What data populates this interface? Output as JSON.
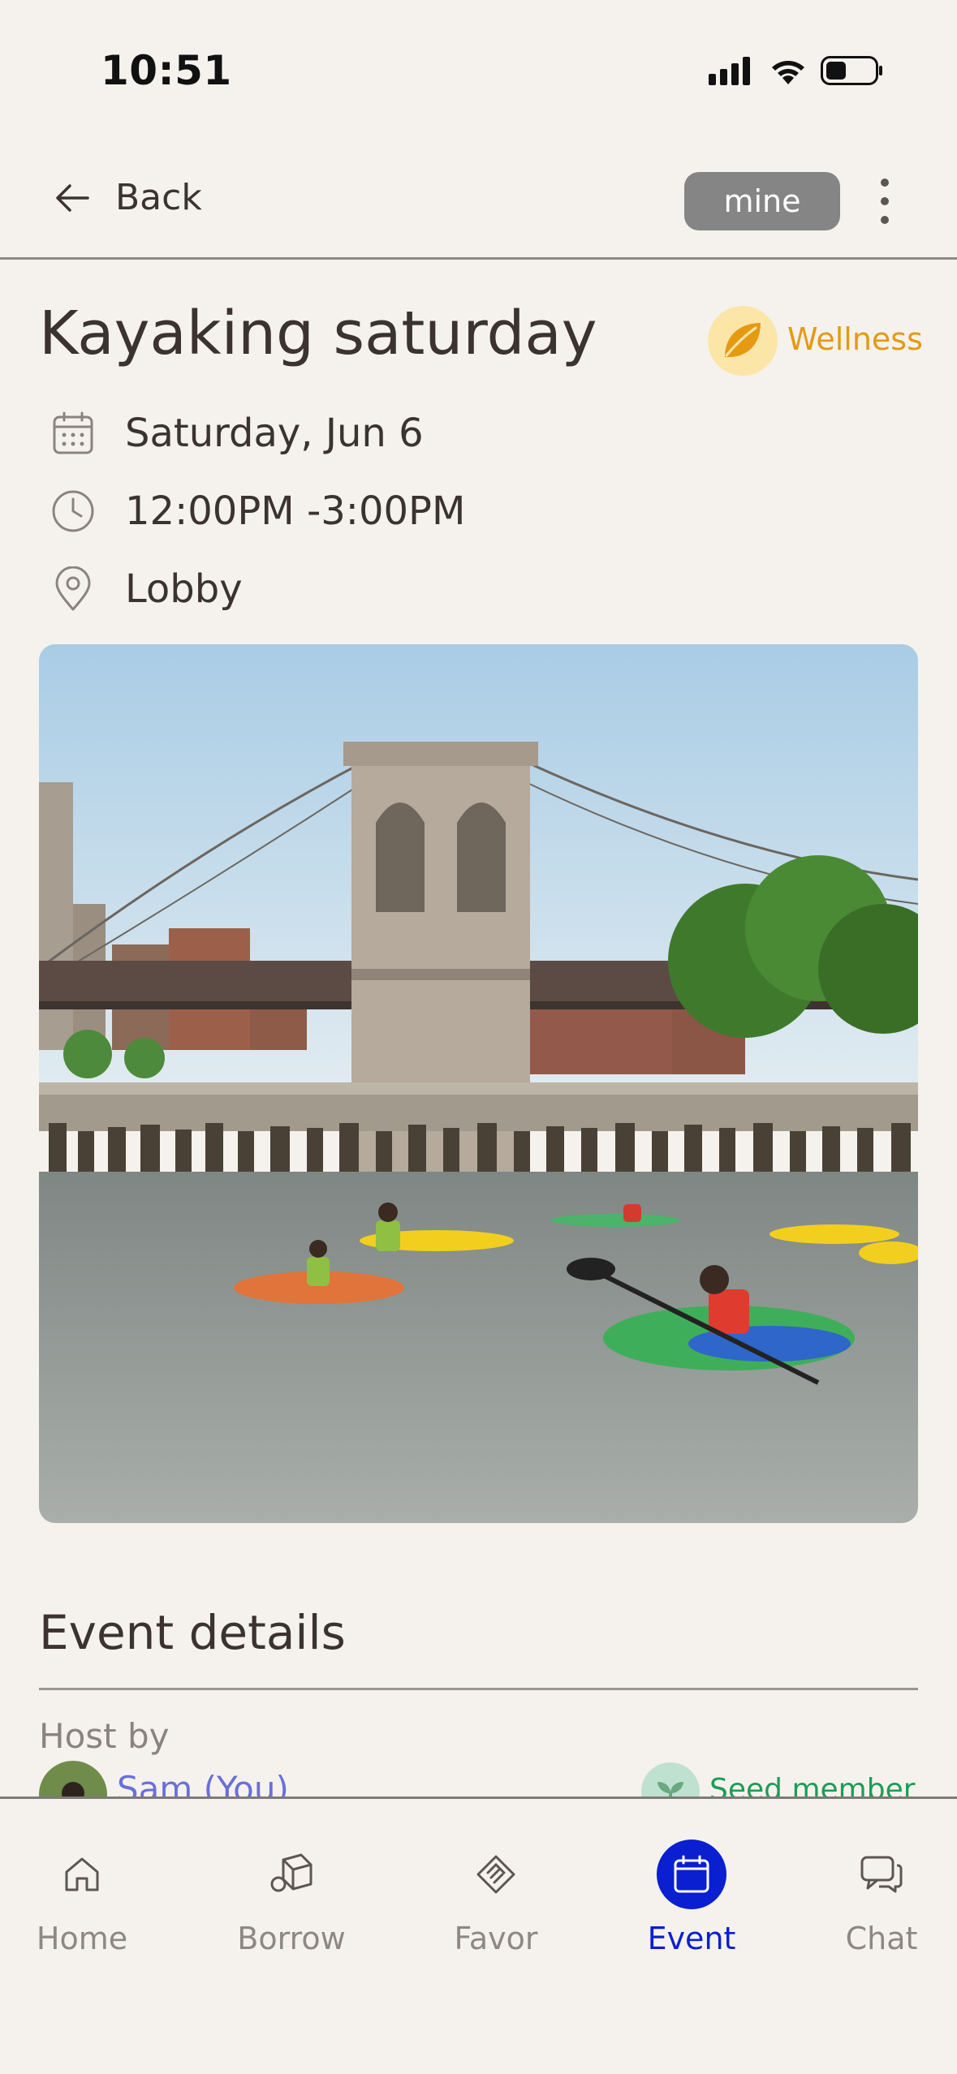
{
  "status_bar": {
    "time": "10:51"
  },
  "header": {
    "back_label": "Back",
    "ownership_badge": "mine"
  },
  "event": {
    "title": "Kayaking saturday",
    "category": {
      "label": "Wellness",
      "icon": "leaf-icon",
      "color": "#e59a12"
    },
    "date": "Saturday, Jun 6",
    "time": "12:00PM -3:00PM",
    "location": "Lobby",
    "photo": "kayakers-under-brooklyn-bridge"
  },
  "details": {
    "section_title": "Event details",
    "host_label": "Host by",
    "host_name": "Sam (You)",
    "member_badge": "Seed member"
  },
  "tabbar": {
    "items": [
      {
        "label": "Home",
        "icon": "home-icon"
      },
      {
        "label": "Borrow",
        "icon": "box-icon"
      },
      {
        "label": "Favor",
        "icon": "handshake-icon"
      },
      {
        "label": "Event",
        "icon": "calendar-icon",
        "active": true
      },
      {
        "label": "Chat",
        "icon": "chat-icon"
      }
    ]
  },
  "colors": {
    "accent": "#0a1fd0",
    "background": "#f5f2ed",
    "host_link": "#6b70d6",
    "seed": "#1e9c58"
  }
}
